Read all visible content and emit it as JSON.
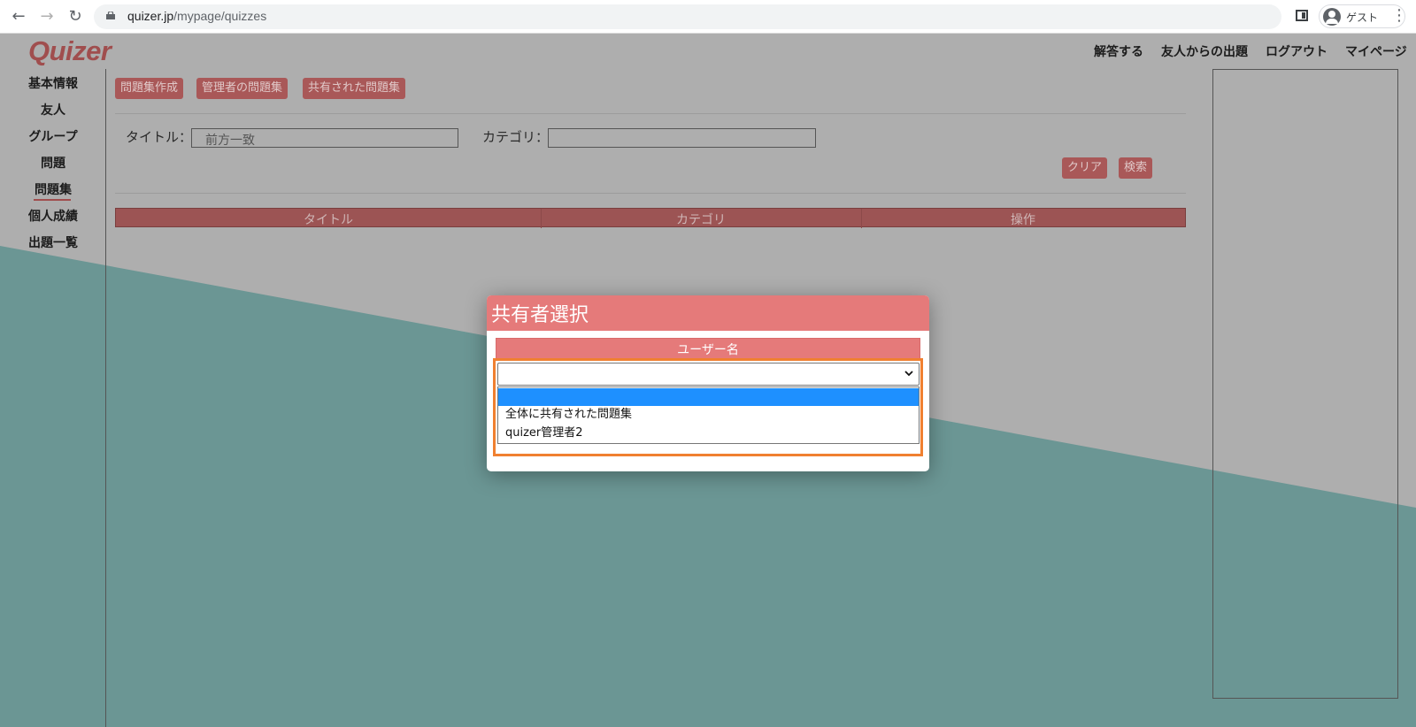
{
  "browser": {
    "url_host": "quizer.jp",
    "url_path": "/mypage/quizzes",
    "profile_label": "ゲスト"
  },
  "site": {
    "logo": "Quizer",
    "top_nav": [
      "解答する",
      "友人からの出題",
      "ログアウト",
      "マイページ"
    ]
  },
  "sidebar": {
    "items": [
      "基本情報",
      "友人",
      "グループ",
      "問題",
      "問題集",
      "個人成績",
      "出題一覧"
    ],
    "active": "問題集"
  },
  "toolbar": {
    "buttons": [
      "問題集作成",
      "管理者の問題集",
      "共有された問題集"
    ]
  },
  "search": {
    "title_label": "タイトル：",
    "title_placeholder": "前方一致",
    "category_label": "カテゴリ：",
    "clear_label": "クリア",
    "search_label": "検索"
  },
  "table": {
    "columns": [
      "タイトル",
      "カテゴリ",
      "操作"
    ]
  },
  "modal": {
    "title": "共有者選択",
    "column_header": "ユーザー名",
    "selected_value": "",
    "options": [
      "",
      "全体に共有された問題集",
      "quizer管理者2"
    ]
  },
  "colors": {
    "accent": "#e57a7a",
    "highlight": "#f08030",
    "selected_option": "#1e90ff",
    "overlay_teal": "#6b9694"
  }
}
